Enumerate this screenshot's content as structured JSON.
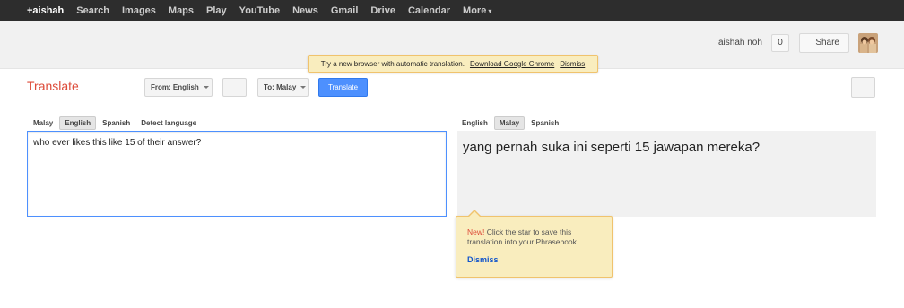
{
  "topnav": {
    "items": [
      "+aishah",
      "Search",
      "Images",
      "Maps",
      "Play",
      "YouTube",
      "News",
      "Gmail",
      "Drive",
      "Calendar",
      "More"
    ],
    "more_caret": "▾"
  },
  "header": {
    "user_name": "aishah noh",
    "notification_count": "0",
    "share_label": "Share"
  },
  "promo": {
    "text": "Try a new browser with automatic translation.",
    "download_link": "Download Google Chrome",
    "dismiss_link": "Dismiss"
  },
  "toolbar": {
    "title": "Translate",
    "from_label": "From: English",
    "to_label": "To: Malay",
    "translate_label": "Translate"
  },
  "source": {
    "tabs": [
      "Malay",
      "English",
      "Spanish",
      "Detect language"
    ],
    "selected": "English",
    "text": "who ever likes this like 15 of their answer?"
  },
  "target": {
    "tabs": [
      "English",
      "Malay",
      "Spanish"
    ],
    "selected": "Malay",
    "text": "yang pernah suka ini seperti 15 jawapan mereka?"
  },
  "tooltip": {
    "new_label": "New!",
    "text": "Click the star to save this translation into your Phrasebook.",
    "dismiss": "Dismiss"
  },
  "colors": {
    "accent_blue": "#4d90fe",
    "title_red": "#dd4b39",
    "promo_yellow": "#f9edbe"
  }
}
